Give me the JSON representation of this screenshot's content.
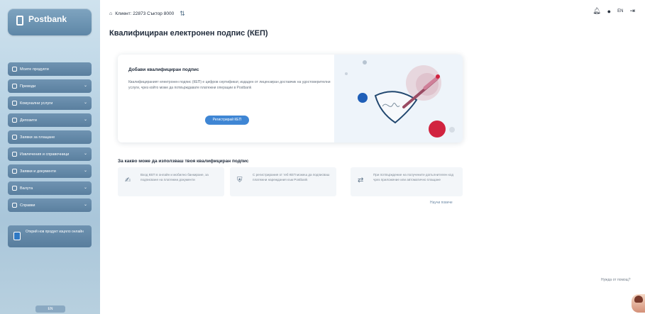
{
  "brand": {
    "logo": "Postbank",
    "tagline": ""
  },
  "topbar": {
    "client": "Клиент: 22873 Съктор 8000",
    "lang": "EN"
  },
  "sidebar": {
    "items": [
      {
        "label": "Моите продукти",
        "icon": "home-icon",
        "chev": false
      },
      {
        "label": "Преводи",
        "icon": "transfer-icon",
        "chev": true
      },
      {
        "label": "Комунални услуги",
        "icon": "utility-icon",
        "chev": true
      },
      {
        "label": "Депозити",
        "icon": "deposit-icon",
        "chev": true
      },
      {
        "label": "Заявки за плащане",
        "icon": "payment-request-icon",
        "chev": false
      },
      {
        "label": "Извлечения и справочници",
        "icon": "statements-icon",
        "chev": true
      },
      {
        "label": "Заявки и документи",
        "icon": "documents-icon",
        "chev": true
      },
      {
        "label": "Валута",
        "icon": "currency-icon",
        "chev": true
      },
      {
        "label": "Справки",
        "icon": "reports-icon",
        "chev": true
      }
    ],
    "promo": "Открий нов продукт изцяло онлайн",
    "lang_button": "EN"
  },
  "page": {
    "title": "Квалифициран електронен подпис (КЕП)",
    "hero": {
      "heading": "Добави квалифициран подпис",
      "paragraph": "Квалифицираният електронен подпис (КЕП) е цифров сертификат, издаден от лицензиран доставчик на удостоверителни услуги, чрез който може да потвърждавате платежни операции в Postbank",
      "button": "Регистрирай КЕП"
    },
    "subtitle": "За какво може да използваш твоя квалифициран подпис",
    "features": [
      {
        "text": "Вход КЕП в онлайн и мобилно банкиране, за подписване на платежни документи",
        "icon": "signature-icon"
      },
      {
        "text": "С регистрирания от теб КЕП можеш да подписваш платежни нареждания към Postbank",
        "icon": "shield-icon"
      },
      {
        "text": "При потвърждение на получените допълнителен код чрез приложение или автоматично плащане",
        "icon": "phone-link-icon"
      }
    ],
    "more_link": "Научи повече",
    "help_link": "Нужда от помощ?"
  },
  "colors": {
    "accent": "#3f86d4",
    "sidebar_item": "#5a7f9f",
    "heart": "#d1233f"
  }
}
